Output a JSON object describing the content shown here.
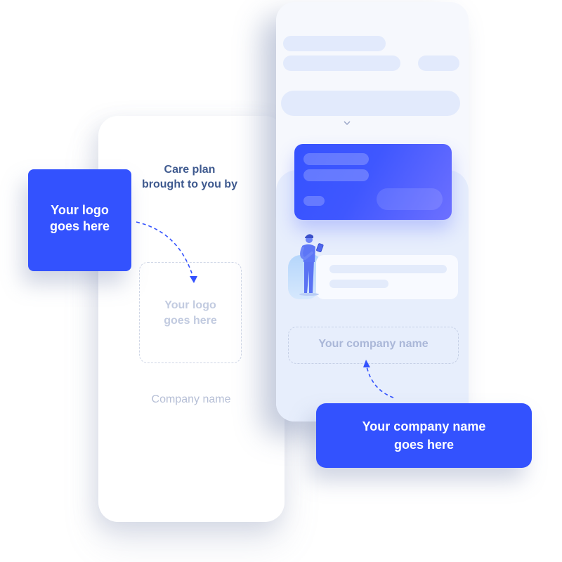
{
  "left_panel": {
    "heading": "Care plan\nbrought to you by",
    "heading_line1": "Care plan",
    "heading_line2": "brought to you by",
    "logo_placeholder_line1": "Your logo",
    "logo_placeholder_line2": "goes here",
    "company_label": "Company name"
  },
  "logo_callout": {
    "line1": "Your logo",
    "line2": "goes here"
  },
  "right_panel": {
    "company_placeholder": "Your company name",
    "chevron_icon": "chevron-down-icon"
  },
  "company_callout": {
    "line1": "Your company name",
    "line2": "goes here"
  },
  "colors": {
    "accent": "#3352fe",
    "heading": "#3f5a8f",
    "placeholder": "#c2cbe0",
    "skeleton": "#e2eafc"
  }
}
